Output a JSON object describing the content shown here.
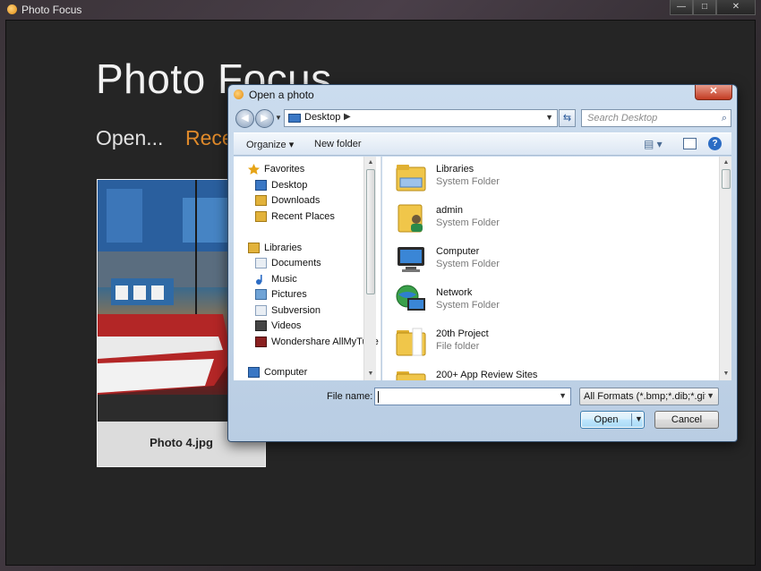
{
  "app": {
    "title": "Photo Focus",
    "heading": "Photo Focus",
    "nav_open": "Open...",
    "nav_recent": "Rece",
    "window_buttons": {
      "minimize": "—",
      "maximize": "□",
      "close": "✕"
    },
    "recent_photo": {
      "caption": "Photo 4.jpg"
    }
  },
  "dialog": {
    "title": "Open a photo",
    "close_label": "✕",
    "address": {
      "location": "Desktop"
    },
    "search_placeholder": "Search Desktop",
    "toolbar": {
      "organize_label": "Organize ▾",
      "new_folder_label": "New folder",
      "views_label": "▤ ▾",
      "help_label": "?"
    },
    "nav_pane": [
      {
        "label": "Favorites",
        "icon": "star-icon",
        "color": "#e6a417"
      },
      {
        "label": "Desktop",
        "icon": "desktop-icon",
        "color": "#3a77c4"
      },
      {
        "label": "Downloads",
        "icon": "downloads-folder-icon",
        "color": "#e2b23a"
      },
      {
        "label": "Recent Places",
        "icon": "recent-places-icon",
        "color": "#e2b23a"
      },
      {
        "label": "Libraries",
        "icon": "libraries-icon",
        "color": "#e2b23a"
      },
      {
        "label": "Documents",
        "icon": "document-icon",
        "color": "#9fb4cc"
      },
      {
        "label": "Music",
        "icon": "music-icon",
        "color": "#2b6cc4"
      },
      {
        "label": "Pictures",
        "icon": "pictures-icon",
        "color": "#6fa3d6"
      },
      {
        "label": "Subversion",
        "icon": "subversion-icon",
        "color": "#9fb4cc"
      },
      {
        "label": "Videos",
        "icon": "video-icon",
        "color": "#444444"
      },
      {
        "label": "Wondershare AllMyTube",
        "icon": "allmytube-icon",
        "color": "#8a2020"
      },
      {
        "label": "Computer",
        "icon": "computer-icon",
        "color": "#3a77c4"
      }
    ],
    "files": [
      {
        "name": "Libraries",
        "type": "System Folder",
        "icon": "libraries-folder-icon"
      },
      {
        "name": "admin",
        "type": "System Folder",
        "icon": "user-folder-icon"
      },
      {
        "name": "Computer",
        "type": "System Folder",
        "icon": "computer-icon"
      },
      {
        "name": "Network",
        "type": "System Folder",
        "icon": "network-icon"
      },
      {
        "name": "20th Project",
        "type": "File folder",
        "icon": "folder-icon"
      },
      {
        "name": "200+ App Review Sites",
        "type": "",
        "icon": "folder-icon"
      }
    ],
    "file_name_label": "File name:",
    "file_name_value": "",
    "filter": "All Formats (*.bmp;*.dib;*.gif;*.",
    "open_label": "Open",
    "cancel_label": "Cancel"
  }
}
